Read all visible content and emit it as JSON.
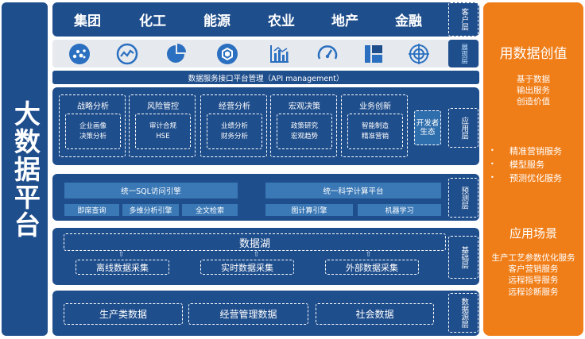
{
  "left_column": {
    "title": "大数据平台"
  },
  "customer_layer": {
    "items": [
      "集团",
      "化工",
      "能源",
      "农业",
      "地产",
      "金融"
    ],
    "tag": "客户层"
  },
  "display_layer": {
    "icons": [
      "scatter-chart-icon",
      "line-trend-icon",
      "pie-chart-icon",
      "hexagon-icon",
      "bar-chart-icon",
      "gauge-icon",
      "column-blocks-icon",
      "radar-target-icon"
    ],
    "tag": "展现层"
  },
  "api_bar": {
    "label": "数据服务接口平台管理（API management）"
  },
  "application_layer": {
    "modules": [
      {
        "title": "战略分析",
        "lines": [
          "企业画像",
          "决策分析"
        ]
      },
      {
        "title": "风险管控",
        "lines": [
          "审计合规",
          "HSE"
        ]
      },
      {
        "title": "经营分析",
        "lines": [
          "业绩分析",
          "财务分析"
        ]
      },
      {
        "title": "宏观决策",
        "lines": [
          "政策研究",
          "宏观趋势"
        ]
      },
      {
        "title": "业务创新",
        "lines": [
          "智能制造",
          "精准营销"
        ]
      }
    ],
    "developer_ecosystem": "开发者生态",
    "tag": "应用层"
  },
  "prediction_layer": {
    "engine_sql": "统一SQL访问引擎",
    "engine_science": "统一科学计算平台",
    "sql_subs": [
      "即席查询",
      "多维分析引擎",
      "全文检索"
    ],
    "science_subs": [
      "图计算引擎",
      "机器学习"
    ],
    "tag": "预测层"
  },
  "base_layer": {
    "lake": "数据湖",
    "collections": [
      "离线数据采集",
      "实时数据采集",
      "外部数据采集"
    ],
    "tag": "基础层"
  },
  "data_source_layer": {
    "items": [
      "生产类数据",
      "经营管理数据",
      "社会数据"
    ],
    "tag": "数据源层"
  },
  "right_column": {
    "title": "用数据创值",
    "subtitle_lines": [
      "基于数据",
      "输出服务",
      "创造价值"
    ],
    "bullet": "•",
    "services": [
      "精准营销服务",
      "模型服务",
      "预测优化服务"
    ],
    "scene_title": "应用场景",
    "scenes": [
      "生产工艺参数优化服务",
      "客户营销服务",
      "远程指导服务",
      "远程诊断服务"
    ]
  },
  "colors": {
    "navy": "#1f4e8c",
    "mid_blue": "#3a78b6",
    "orange": "#f07e18",
    "display_bg": "#e6e9ee",
    "icon_blue": "#2a6fc0"
  }
}
